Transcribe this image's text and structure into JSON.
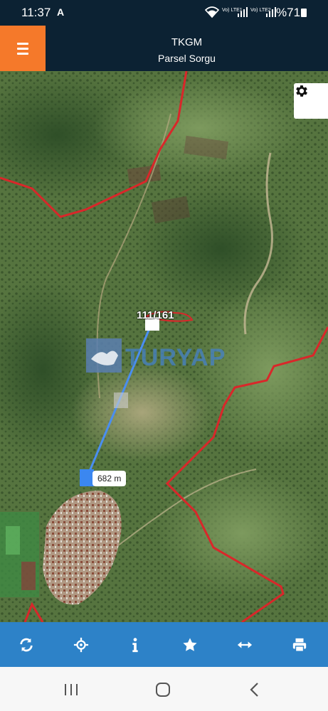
{
  "status_bar": {
    "time": "11:37",
    "notification_icon": "a-icon",
    "sim1_label": "Vo) LTE1",
    "sim2_label": "Vo) LTE2",
    "battery": "%71"
  },
  "header": {
    "title": "TKGM",
    "subtitle": "Parsel Sorgu",
    "accent_color": "#f5792a",
    "bar_color": "#0c2233"
  },
  "map": {
    "parcel_label": "111/161",
    "distance_label": "682 m",
    "watermark_text": "TURYAP",
    "boundary_color": "#d9272a",
    "measure_line_color": "#4a8ef0"
  },
  "toolbar": {
    "color": "#2d82c8",
    "tools": [
      "refresh-icon",
      "locate-icon",
      "info-icon",
      "star-icon",
      "measure-icon",
      "print-icon"
    ]
  },
  "nav_bar": {
    "buttons": [
      "recent-apps-icon",
      "home-icon",
      "back-icon"
    ]
  }
}
